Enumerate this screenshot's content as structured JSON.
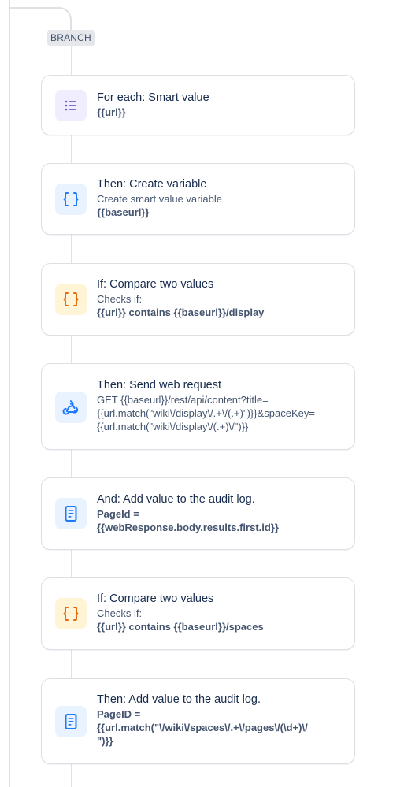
{
  "branch": {
    "label": "BRANCH"
  },
  "steps": [
    {
      "title": "For each: Smart value",
      "value": "{{url}}",
      "icon": "list-icon",
      "color": "#6e5dc6"
    },
    {
      "title": "Then: Create variable",
      "description": "Create smart value variable",
      "value": "{{baseurl}}",
      "icon": "curly-braces-icon",
      "color": "#1d7afc"
    },
    {
      "title": "If: Compare two values",
      "description": "Checks if:",
      "value": "{{url}} contains {{baseurl}}/display",
      "icon": "curly-braces-icon",
      "color": "#e56910"
    },
    {
      "title": "Then: Send web request",
      "line1": "GET {{baseurl}}/rest/api/content?title=",
      "line2": "{{url.match(\"wiki\\/display\\/.+\\/(.+)\")}}&spaceKey=",
      "line3": "{{url.match(\"wiki\\/display\\/(.+)\\/\")}}",
      "icon": "webhook-icon",
      "color": "#1d7afc"
    },
    {
      "title": "And: Add value to the audit log.",
      "value1": "PageId =",
      "value2": "{{webResponse.body.results.first.id}}",
      "icon": "document-icon",
      "color": "#1d7afc"
    },
    {
      "title": "If: Compare two values",
      "description": "Checks if:",
      "value": "{{url}} contains {{baseurl}}/spaces",
      "icon": "curly-braces-icon",
      "color": "#e56910"
    },
    {
      "title": "Then: Add value to the audit log.",
      "value1": "PageID =",
      "value2": "{{url.match(\"\\/wiki\\/spaces\\/.+\\/pages\\/(\\d+)\\/",
      "value3": "\")}}",
      "icon": "document-icon",
      "color": "#1d7afc"
    }
  ]
}
